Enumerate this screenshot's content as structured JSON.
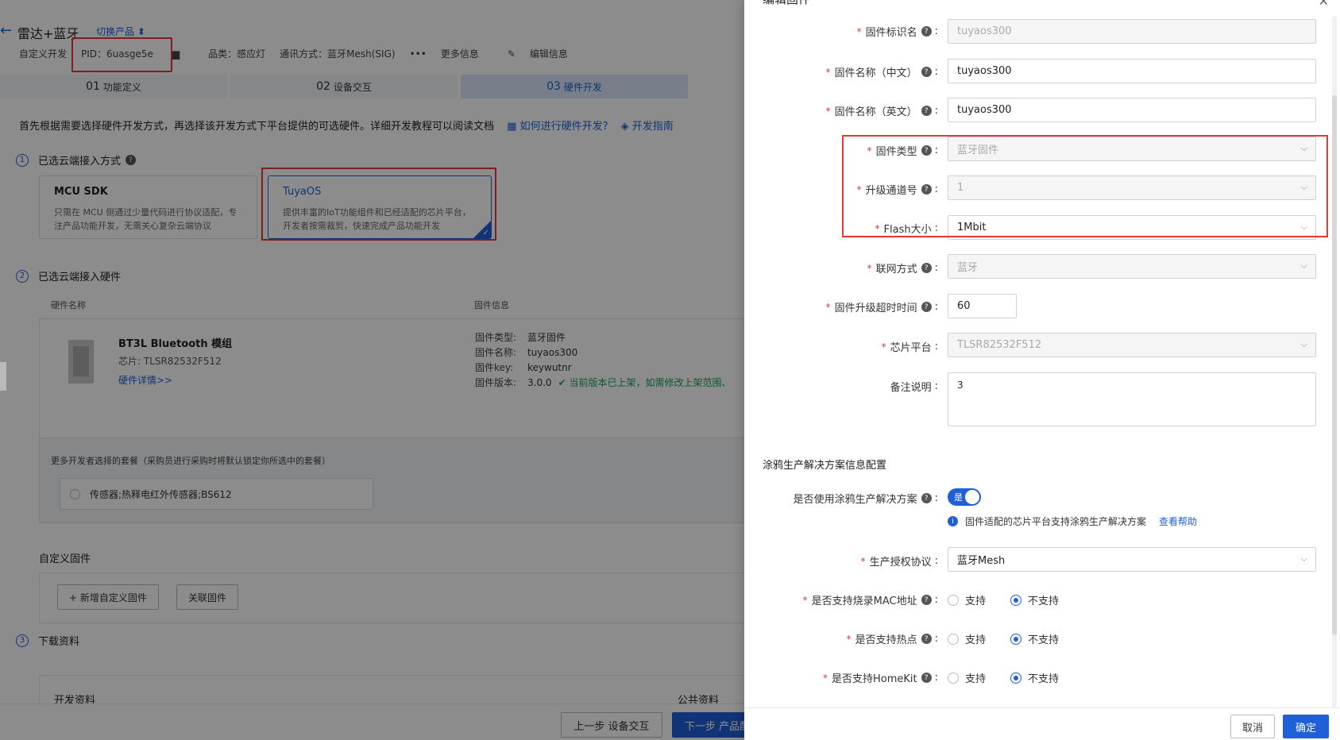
{
  "header": {
    "back_icon": "←",
    "product_title": "雷达+蓝牙",
    "switch_product": "切换产品 ⬍",
    "meta": {
      "dev_type": "自定义开发",
      "pid": "PID：6uasge5e",
      "copy_icon": "▆",
      "category": "品类：感应灯",
      "protocol": "通讯方式：蓝牙Mesh(SIG)",
      "more_icon": "•••",
      "more": "更多信息",
      "edit_icon": "✎",
      "edit": "编辑信息"
    }
  },
  "steps": [
    {
      "num": "01",
      "label": "功能定义"
    },
    {
      "num": "02",
      "label": "设备交互"
    },
    {
      "num": "03",
      "label": "硬件开发"
    }
  ],
  "intro": {
    "text": "首先根据需要选择硬件开发方式，再选择该开发方式下平台提供的可选硬件。详细开发教程可以阅读文档",
    "link1_icon": "▦",
    "link1": "如何进行硬件开发?",
    "link2_icon": "◈",
    "link2": "开发指南"
  },
  "section1": {
    "num": "1",
    "title": "已选云端接入方式",
    "q": "?",
    "cards": [
      {
        "title": "MCU SDK",
        "desc": "只需在 MCU 侧通过少量代码进行协议适配，专注产品功能开发，无需关心复杂云端协议"
      },
      {
        "title": "TuyaOS",
        "desc": "提供丰富的IoT功能组件和已经适配的芯片平台，开发者按需裁剪，快速完成产品功能开发"
      }
    ],
    "check": "✓"
  },
  "section2": {
    "num": "2",
    "title": "已选云端接入硬件",
    "col_hw": "硬件名称",
    "col_fw": "固件信息",
    "hw_name": "BT3L Bluetooth 模组",
    "hw_chip": "芯片: TLSR82532F512",
    "hw_link": "硬件详情>>",
    "fw": [
      {
        "label": "固件类型:",
        "value": "蓝牙固件"
      },
      {
        "label": "固件名称:",
        "value": "tuyaos300"
      },
      {
        "label": "固件key:",
        "value": "keywutnr"
      },
      {
        "label": "固件版本:",
        "value": "3.0.0"
      }
    ],
    "fw_ok_icon": "✔",
    "fw_ok": "当前版本已上架，如需修改上架范围、",
    "combo_title": "更多开发者选择的套餐（采购员进行采购时将默认锁定你所选中的套餐）",
    "combo_item": "传感器;热释电红外传感器;BS612"
  },
  "custom_fw": {
    "title": "自定义固件",
    "add_btn": "+ 新增自定义固件",
    "link_btn": "关联固件"
  },
  "section3": {
    "num": "3",
    "title": "下载资料",
    "dev_docs": "开发资料",
    "public_docs": "公共资料"
  },
  "bottom": {
    "prev": "上一步 设备交互",
    "next": "下一步 产品配置"
  },
  "drawer": {
    "title": "编辑固件",
    "close_icon": "✕",
    "q": "?",
    "chev": "⌵",
    "fields": {
      "fw_id": {
        "label": "固件标识名",
        "value": "tuyaos300"
      },
      "fw_name_cn": {
        "label": "固件名称（中文）",
        "value": "tuyaos300"
      },
      "fw_name_en": {
        "label": "固件名称（英文）",
        "value": "tuyaos300"
      },
      "fw_type": {
        "label": "固件类型",
        "value": "蓝牙固件"
      },
      "channel": {
        "label": "升级通道号",
        "value": "1"
      },
      "flash": {
        "label": "Flash大小",
        "value": "1Mbit"
      },
      "network": {
        "label": "联网方式",
        "value": "蓝牙"
      },
      "timeout": {
        "label": "固件升级超时时间",
        "value": "60"
      },
      "chip": {
        "label": "芯片平台",
        "value": "TLSR82532F512"
      },
      "remark": {
        "label": "备注说明",
        "value": "3"
      }
    },
    "production": {
      "heading": "涂鸦生产解决方案信息配置",
      "use_label": "是否使用涂鸦生产解决方案",
      "switch_text": "是",
      "info_icon": "i",
      "hint": "固件适配的芯片平台支持涂鸦生产解决方案",
      "hint_link": "查看帮助",
      "protocol_label": "生产授权协议",
      "protocol_value": "蓝牙Mesh",
      "mac_label": "是否支持烧录MAC地址",
      "hotspot_label": "是否支持热点",
      "homekit_label": "是否支持HomeKit",
      "support": "支持",
      "not_support": "不支持"
    },
    "cancel": "取消",
    "confirm": "确定"
  }
}
